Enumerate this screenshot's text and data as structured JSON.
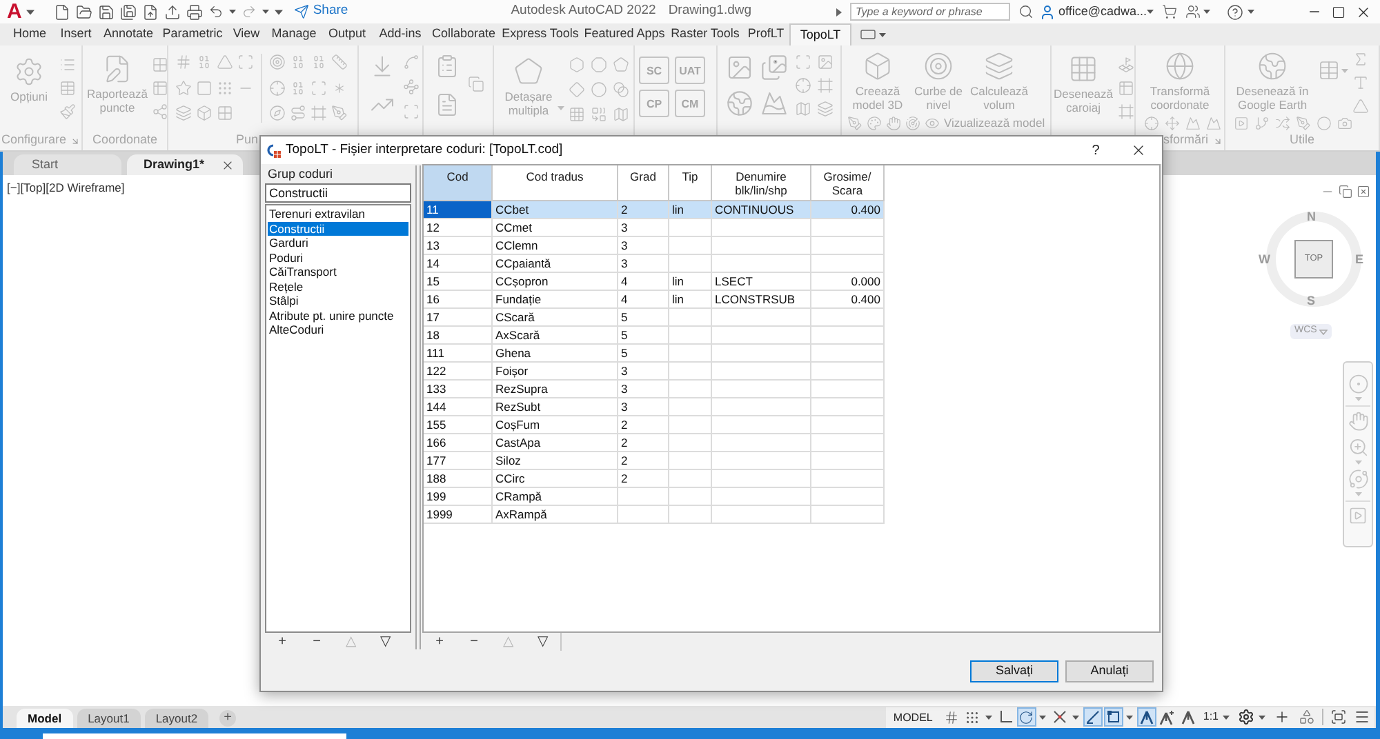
{
  "title_bar": {
    "logo": "A",
    "share": "Share",
    "app_title": "Autodesk AutoCAD 2022",
    "file_name": "Drawing1.dwg",
    "search": {
      "placeholder": "Type a keyword or phrase"
    },
    "user": "office@cadwa..."
  },
  "ribbon_tabs": [
    {
      "label": "Home",
      "selected": false
    },
    {
      "label": "Insert",
      "selected": false
    },
    {
      "label": "Annotate",
      "selected": false
    },
    {
      "label": "Parametric",
      "selected": false
    },
    {
      "label": "View",
      "selected": false
    },
    {
      "label": "Manage",
      "selected": false
    },
    {
      "label": "Output",
      "selected": false
    },
    {
      "label": "Add-ins",
      "selected": false
    },
    {
      "label": "Collaborate",
      "selected": false
    },
    {
      "label": "Express Tools",
      "selected": false
    },
    {
      "label": "Featured Apps",
      "selected": false
    },
    {
      "label": "Raster Tools",
      "selected": false
    },
    {
      "label": "ProfLT",
      "selected": false
    },
    {
      "label": "TopoLT",
      "selected": true
    }
  ],
  "ribbon": {
    "disabled": true,
    "panels": [
      {
        "kind": "settings",
        "label": "Configurare",
        "launcher": true,
        "buttons": [
          "Opțiuni"
        ]
      },
      {
        "kind": "coordinates",
        "label": "Coordonate",
        "buttons": [
          "Raportează puncte"
        ]
      },
      {
        "kind": "points",
        "label": "Pun"
      },
      {
        "kind": "lines"
      },
      {
        "kind": "documents"
      },
      {
        "kind": "detach",
        "buttons": [
          "Detașare multipla"
        ]
      },
      {
        "kind": "tiles",
        "tiles": [
          "SC",
          "UAT",
          "CP",
          "CM"
        ]
      },
      {
        "kind": "images"
      },
      {
        "kind": "model",
        "buttons": [
          "Creează model 3D",
          "Curbe de nivel",
          "Calculează volum"
        ],
        "small_button": "Vizualizează model"
      },
      {
        "kind": "grid",
        "buttons": [
          "Desenează caroiaj"
        ]
      },
      {
        "kind": "transform",
        "label": "sformări",
        "launcher": true,
        "buttons": [
          "Transformă coordonate"
        ]
      },
      {
        "kind": "utilities",
        "label": "Utile",
        "buttons": [
          "Desenează în Google Earth"
        ]
      }
    ]
  },
  "document_tabs": [
    {
      "label": "Start",
      "selected": false
    },
    {
      "label": "Drawing1*",
      "selected": true
    }
  ],
  "viewport": {
    "controls": [
      "[−]",
      "[Top]",
      "[2D Wireframe]"
    ],
    "viewcube": {
      "face": "TOP",
      "north": "N",
      "east": "E",
      "south": "S",
      "west": "W",
      "coordinate_system": "WCS"
    }
  },
  "dialog": {
    "title": "TopoLT - Fișier interpretare coduri: [TopoLT.cod]",
    "help": "?",
    "group_label": "Grup coduri",
    "group_field": {
      "value": "Constructii"
    },
    "groups": [
      {
        "label": "Terenuri extravilan",
        "selected": false
      },
      {
        "label": "Constructii",
        "selected": true
      },
      {
        "label": "Garduri",
        "selected": false
      },
      {
        "label": "Poduri",
        "selected": false
      },
      {
        "label": "CăiTransport",
        "selected": false
      },
      {
        "label": "Rețele",
        "selected": false
      },
      {
        "label": "Stâlpi",
        "selected": false
      },
      {
        "label": "Atribute pt. unire puncte",
        "selected": false
      },
      {
        "label": "AlteCoduri",
        "selected": false
      }
    ],
    "group_tools": [
      {
        "label": "+",
        "disabled": false
      },
      {
        "label": "−",
        "disabled": false
      },
      {
        "label": "△",
        "disabled": true
      },
      {
        "label": "▽",
        "disabled": false
      }
    ],
    "table": {
      "columns": [
        {
          "label": "Cod",
          "selected": true
        },
        {
          "label": "Cod tradus",
          "selected": false
        },
        {
          "label": "Grad",
          "selected": false
        },
        {
          "label": "Tip",
          "selected": false
        },
        {
          "label": "Denumire blk/lin/shp",
          "selected": false
        },
        {
          "label": "Grosime/ Scara",
          "selected": false
        }
      ],
      "rows": [
        {
          "selected": true,
          "cod": "11",
          "cod_tradus": "CCbet",
          "grad": "2",
          "tip": "lin",
          "denumire": "CONTINUOUS",
          "grosime": "0.400"
        },
        {
          "selected": false,
          "cod": "12",
          "cod_tradus": "CCmet",
          "grad": "3"
        },
        {
          "selected": false,
          "cod": "13",
          "cod_tradus": "CClemn",
          "grad": "3"
        },
        {
          "selected": false,
          "cod": "14",
          "cod_tradus": "CCpaiantă",
          "grad": "3"
        },
        {
          "selected": false,
          "cod": "15",
          "cod_tradus": "CCșopron",
          "grad": "4",
          "tip": "lin",
          "denumire": "LSECT",
          "grosime": "0.000"
        },
        {
          "selected": false,
          "cod": "16",
          "cod_tradus": "Fundație",
          "grad": "4",
          "tip": "lin",
          "denumire": "LCONSTRSUB",
          "grosime": "0.400"
        },
        {
          "selected": false,
          "cod": "17",
          "cod_tradus": "CScară",
          "grad": "5"
        },
        {
          "selected": false,
          "cod": "18",
          "cod_tradus": "AxScară",
          "grad": "5"
        },
        {
          "selected": false,
          "cod": "111",
          "cod_tradus": "Ghena",
          "grad": "5"
        },
        {
          "selected": false,
          "cod": "122",
          "cod_tradus": "Foișor",
          "grad": "3"
        },
        {
          "selected": false,
          "cod": "133",
          "cod_tradus": "RezSupra",
          "grad": "3"
        },
        {
          "selected": false,
          "cod": "144",
          "cod_tradus": "RezSubt",
          "grad": "3"
        },
        {
          "selected": false,
          "cod": "155",
          "cod_tradus": "CoșFum",
          "grad": "2"
        },
        {
          "selected": false,
          "cod": "166",
          "cod_tradus": "CastApa",
          "grad": "2"
        },
        {
          "selected": false,
          "cod": "177",
          "cod_tradus": "Siloz",
          "grad": "2"
        },
        {
          "selected": false,
          "cod": "188",
          "cod_tradus": "CCirc",
          "grad": "2"
        },
        {
          "selected": false,
          "cod": "199",
          "cod_tradus": "CRampă"
        },
        {
          "selected": false,
          "cod": "1999",
          "cod_tradus": "AxRampă"
        }
      ]
    },
    "table_tools": [
      {
        "label": "+",
        "disabled": false
      },
      {
        "label": "−",
        "disabled": false
      },
      {
        "label": "△",
        "disabled": true
      },
      {
        "label": "▽",
        "disabled": false
      }
    ],
    "buttons": [
      {
        "label": "Salvați",
        "default": true
      },
      {
        "label": "Anulați",
        "default": false
      }
    ]
  },
  "layout_tabs": [
    {
      "label": "Model",
      "selected": true
    },
    {
      "label": "Layout1",
      "selected": false
    },
    {
      "label": "Layout2",
      "selected": false
    }
  ],
  "add_layout": "+",
  "status_bar": {
    "model": "MODEL",
    "toggles": [
      {
        "kind": "grid",
        "on": false
      },
      {
        "kind": "snap",
        "on": false
      },
      {
        "kind": "ortho",
        "on": false
      },
      {
        "kind": "polar",
        "on": true
      },
      {
        "kind": "isometric",
        "on": false
      },
      {
        "kind": "tracking",
        "on": true
      },
      {
        "kind": "osnap",
        "on": true
      },
      {
        "kind": "annotation_visibility",
        "on": true
      },
      {
        "kind": "autoscale",
        "on": false
      },
      {
        "kind": "annotation_monitor",
        "on": false
      }
    ],
    "annotation_scale": "1:1"
  }
}
